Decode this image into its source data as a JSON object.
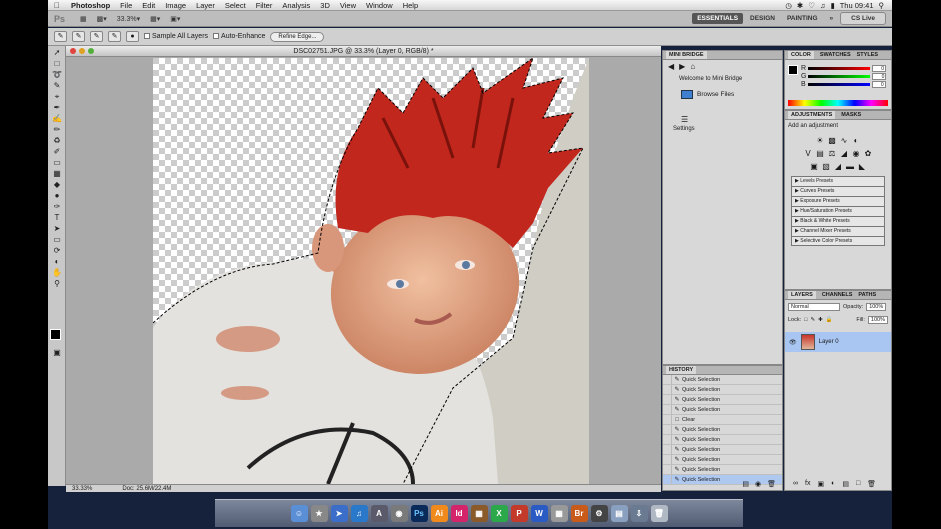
{
  "menubar": {
    "app": "Photoshop",
    "items": [
      "File",
      "Edit",
      "Image",
      "Layer",
      "Select",
      "Filter",
      "Analysis",
      "3D",
      "View",
      "Window",
      "Help"
    ],
    "clock": "Thu 09:41"
  },
  "appbar": {
    "logo": "Ps",
    "zoom": "33.3",
    "workspaces": [
      {
        "label": "ESSENTIALS",
        "active": true
      },
      {
        "label": "DESIGN",
        "active": false
      },
      {
        "label": "PAINTING",
        "active": false
      }
    ],
    "cs_live": "CS Live"
  },
  "options": {
    "sample_all_layers": "Sample All Layers",
    "auto_enhance": "Auto-Enhance",
    "refine_edge": "Refine Edge..."
  },
  "document": {
    "title": "DSC02751.JPG @ 33.3% (Layer 0, RGB/8) *",
    "status_zoom": "33.33%",
    "status_doc": "Doc: 25.6M/22.4M"
  },
  "minibridge": {
    "tab": "MINI BRIDGE",
    "welcome": "Welcome to Mini Bridge",
    "browse": "Browse Files",
    "settings": "Settings"
  },
  "history": {
    "tab": "HISTORY",
    "items": [
      {
        "label": "Quick Selection",
        "selected": false
      },
      {
        "label": "Quick Selection",
        "selected": false
      },
      {
        "label": "Quick Selection",
        "selected": false
      },
      {
        "label": "Quick Selection",
        "selected": false
      },
      {
        "label": "Clear",
        "selected": false
      },
      {
        "label": "Quick Selection",
        "selected": false
      },
      {
        "label": "Quick Selection",
        "selected": false
      },
      {
        "label": "Quick Selection",
        "selected": false
      },
      {
        "label": "Quick Selection",
        "selected": false
      },
      {
        "label": "Quick Selection",
        "selected": false
      },
      {
        "label": "Quick Selection",
        "selected": true
      }
    ]
  },
  "color_panel": {
    "tabs": [
      "COLOR",
      "SWATCHES",
      "STYLES"
    ],
    "channels": [
      {
        "name": "R",
        "value": "0"
      },
      {
        "name": "G",
        "value": "0"
      },
      {
        "name": "B",
        "value": "0"
      }
    ]
  },
  "adjustments": {
    "tabs": [
      "ADJUSTMENTS",
      "MASKS"
    ],
    "heading": "Add an adjustment",
    "presets": [
      "Levels Presets",
      "Curves Presets",
      "Exposure Presets",
      "Hue/Saturation Presets",
      "Black & White Presets",
      "Channel Mixer Presets",
      "Selective Color Presets"
    ]
  },
  "layers": {
    "tabs": [
      "LAYERS",
      "CHANNELS",
      "PATHS"
    ],
    "blend_mode": "Normal",
    "opacity_label": "Opacity:",
    "opacity": "100%",
    "lock_label": "Lock:",
    "fill_label": "Fill:",
    "fill": "100%",
    "layer_name": "Layer 0"
  }
}
